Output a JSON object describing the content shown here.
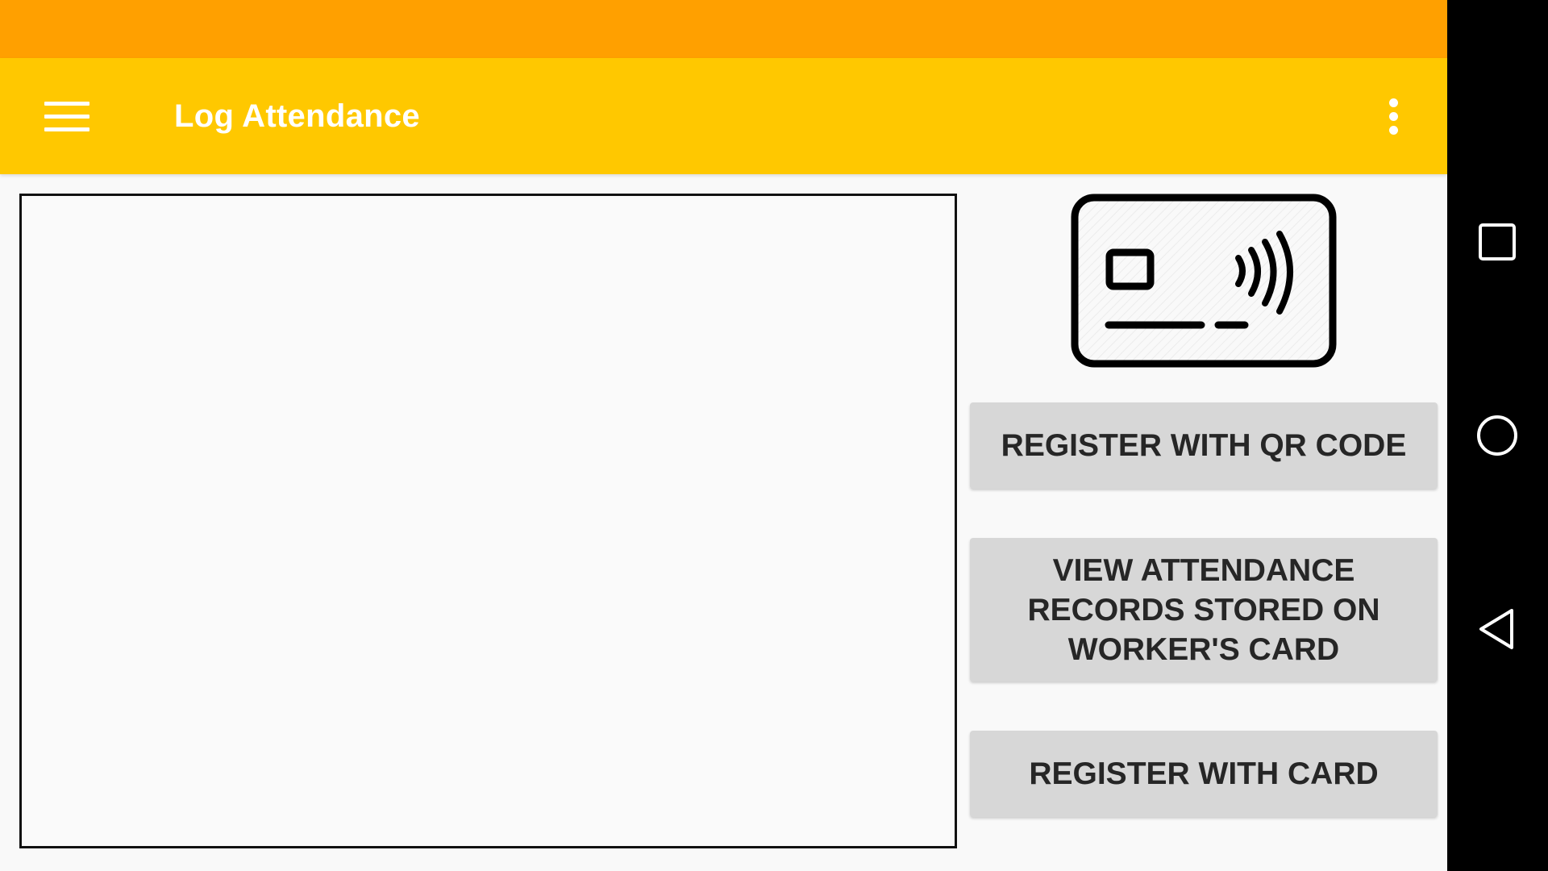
{
  "app_bar": {
    "title": "Log Attendance",
    "color": "#ffc800",
    "status_bar_color": "#ffa000",
    "menu_icon": "hamburger-menu-icon",
    "overflow_icon": "more-vert-icon"
  },
  "main": {
    "card_icon": "contactless-card-icon",
    "buttons": {
      "register_qr": "REGISTER WITH QR CODE",
      "view_records": "VIEW ATTENDANCE RECORDS STORED ON WORKER'S CARD",
      "register_card": "REGISTER WITH CARD"
    }
  },
  "nav_bar": {
    "recents_icon": "square-recents-icon",
    "home_icon": "circle-home-icon",
    "back_icon": "triangle-back-icon"
  }
}
